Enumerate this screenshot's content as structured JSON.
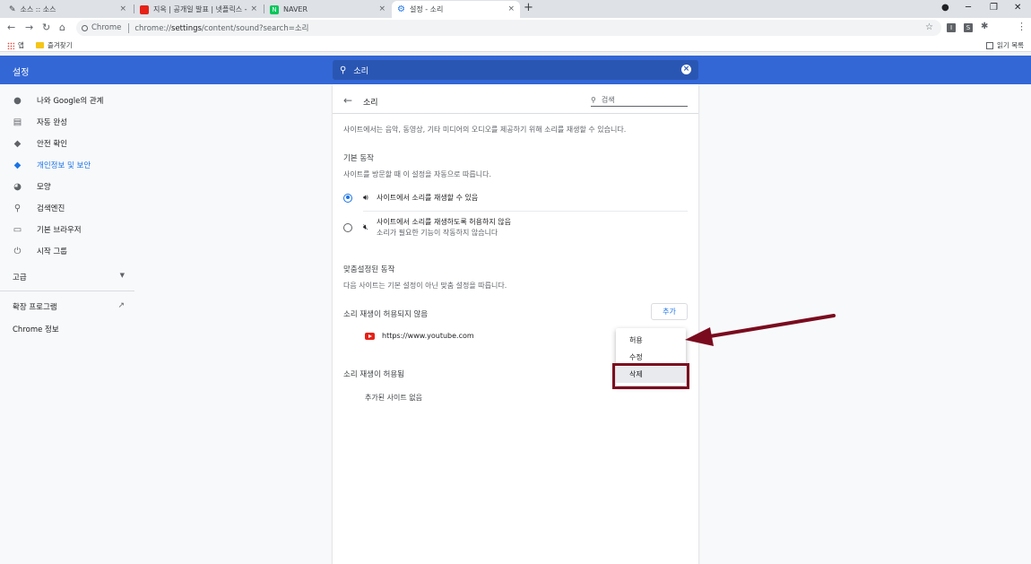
{
  "tabs": [
    {
      "title": "소스 :: 소스",
      "icon": "pencil-icon"
    },
    {
      "title": "지옥 | 공개일 발표 | 넷플릭스 -",
      "icon": "youtube-icon"
    },
    {
      "title": "NAVER",
      "icon": "naver-icon"
    },
    {
      "title": "설정 - 소리",
      "icon": "settings-gear-icon"
    }
  ],
  "tab_close_glyph": "×",
  "new_tab_glyph": "+",
  "toolbar": {
    "chip_label": "Chrome",
    "url_scheme": "chrome://",
    "url_path": "settings",
    "url_rest": "/content/sound?search=소리"
  },
  "extensions": [
    "I",
    "S"
  ],
  "bookmarks": {
    "apps_label": "앱",
    "favorites_label": "즐겨찾기",
    "reading_list_label": "읽기 목록"
  },
  "header": {
    "title": "설정",
    "search_value": "소리"
  },
  "sidebar": {
    "items": [
      {
        "label": "나와 Google의 관계",
        "icon": "person-icon"
      },
      {
        "label": "자동 완성",
        "icon": "clipboard-icon"
      },
      {
        "label": "안전 확인",
        "icon": "shield-check-icon"
      },
      {
        "label": "개인정보 및 보안",
        "icon": "shield-icon"
      },
      {
        "label": "모양",
        "icon": "palette-icon"
      },
      {
        "label": "검색엔진",
        "icon": "search-icon"
      },
      {
        "label": "기본 브라우저",
        "icon": "browser-icon"
      },
      {
        "label": "시작 그룹",
        "icon": "power-icon"
      }
    ],
    "advanced_label": "고급",
    "extensions_label": "확장 프로그램",
    "about_label": "Chrome 정보"
  },
  "content": {
    "title": "소리",
    "search_placeholder": "검색",
    "description": "사이트에서는 음악, 동영상, 기타 미디어의 오디오를 제공하기 위해 소리를 재생할 수 있습니다.",
    "default_behavior": {
      "heading": "기본 동작",
      "subtext": "사이트를 방문할 때 이 설정을 자동으로 따릅니다.",
      "options": [
        {
          "label": "사이트에서 소리를 재생할 수 있음",
          "sub": "",
          "checked": true
        },
        {
          "label": "사이트에서 소리를 재생하도록 허용하지 않음",
          "sub": "소리가 필요한 기능이 작동하지 않습니다",
          "checked": false
        }
      ]
    },
    "custom_behavior": {
      "heading": "맞춤설정된 동작",
      "subtext": "다음 사이트는 기본 설정이 아닌 맞춤 설정을 따릅니다."
    },
    "blocked": {
      "heading": "소리 재생이 허용되지 않음",
      "add_label": "추가",
      "sites": [
        "https://www.youtube.com"
      ]
    },
    "allowed": {
      "heading": "소리 재생이 허용됨",
      "empty_label": "추가된 사이트 없음"
    }
  },
  "context_menu": {
    "items": [
      "허용",
      "수정",
      "삭제"
    ],
    "highlighted": "삭제"
  },
  "colors": {
    "header_blue": "#3367d6",
    "accent": "#1a73e8",
    "annotation": "#7a0b1e"
  }
}
